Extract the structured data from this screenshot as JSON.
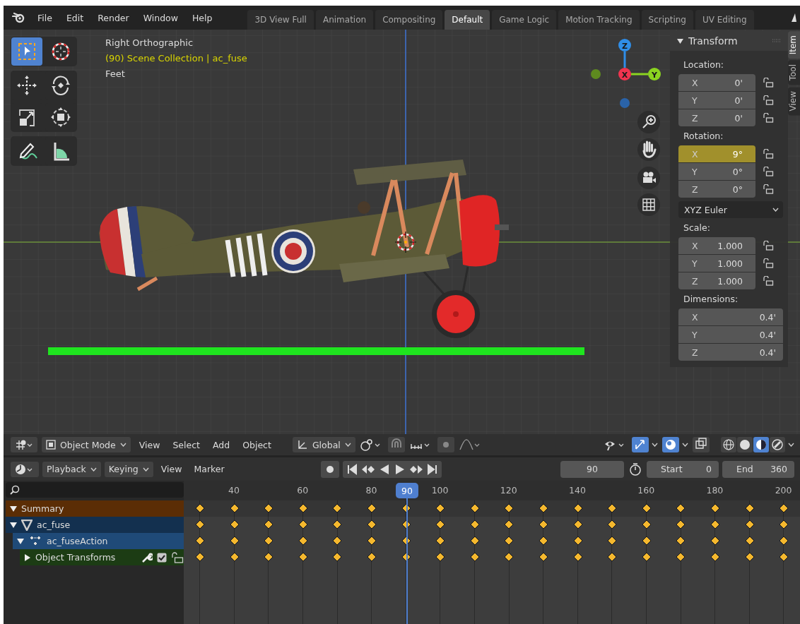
{
  "menus": [
    "File",
    "Edit",
    "Render",
    "Window",
    "Help"
  ],
  "workspaces": [
    {
      "label": "3D View Full",
      "selected": false
    },
    {
      "label": "Animation",
      "selected": false
    },
    {
      "label": "Compositing",
      "selected": false
    },
    {
      "label": "Default",
      "selected": true
    },
    {
      "label": "Game Logic",
      "selected": false
    },
    {
      "label": "Motion Tracking",
      "selected": false
    },
    {
      "label": "Scripting",
      "selected": false
    },
    {
      "label": "UV Editing",
      "selected": false
    }
  ],
  "viewport": {
    "view_name": "Right Orthographic",
    "collection": "(90) Scene Collection | ac_fuse",
    "units": "Feet",
    "tool_groups": [
      [
        {
          "kind": "select",
          "selected": true
        },
        {
          "kind": "cursor",
          "selected": false
        }
      ],
      [
        {
          "kind": "move",
          "selected": false
        },
        {
          "kind": "rotate",
          "selected": false
        },
        {
          "kind": "scale",
          "selected": false
        },
        {
          "kind": "transform",
          "selected": false
        }
      ],
      [
        {
          "kind": "annotate",
          "selected": false
        },
        {
          "kind": "measure",
          "selected": false
        }
      ]
    ],
    "gizmo": {
      "z": "Z",
      "x": "X",
      "y": "Y"
    }
  },
  "sidebar": {
    "tabs": [
      {
        "label": "Item",
        "selected": true
      },
      {
        "label": "Tool",
        "selected": false
      },
      {
        "label": "View",
        "selected": false
      }
    ],
    "panel_title": "Transform",
    "expanded": true,
    "sections": [
      {
        "label": "Location:",
        "kind": "lockable",
        "fields": [
          {
            "axis": "X",
            "value": "0'",
            "keyed": false
          },
          {
            "axis": "Y",
            "value": "0'",
            "keyed": false
          },
          {
            "axis": "Z",
            "value": "0'",
            "keyed": false
          }
        ]
      },
      {
        "label": "Rotation:",
        "kind": "lockable",
        "fields": [
          {
            "axis": "X",
            "value": "9°",
            "keyed": true
          },
          {
            "axis": "Y",
            "value": "0°",
            "keyed": false
          },
          {
            "axis": "Z",
            "value": "0°",
            "keyed": false
          }
        ],
        "mode": "XYZ Euler"
      },
      {
        "label": "Scale:",
        "kind": "lockable",
        "fields": [
          {
            "axis": "X",
            "value": "1.000",
            "keyed": false
          },
          {
            "axis": "Y",
            "value": "1.000",
            "keyed": false
          },
          {
            "axis": "Z",
            "value": "1.000",
            "keyed": false
          }
        ]
      },
      {
        "label": "Dimensions:",
        "kind": "plain",
        "fields": [
          {
            "axis": "X",
            "value": "0.4'",
            "keyed": false
          },
          {
            "axis": "Y",
            "value": "0.4'",
            "keyed": false
          },
          {
            "axis": "Z",
            "value": "0.4'",
            "keyed": false
          }
        ]
      }
    ]
  },
  "header_3d": {
    "mode": "Object Mode",
    "menus": [
      "View",
      "Select",
      "Add",
      "Object"
    ],
    "orientation": "Global",
    "toggles": [
      {
        "kind": "gizmo",
        "on": true
      },
      {
        "kind": "overlay",
        "on": true
      },
      {
        "kind": "xray",
        "on": false
      }
    ],
    "shading": [
      {
        "kind": "wireframe",
        "selected": false
      },
      {
        "kind": "solid",
        "selected": false
      },
      {
        "kind": "material",
        "selected": true
      },
      {
        "kind": "rendered",
        "selected": false
      }
    ]
  },
  "timeline": {
    "menus": [
      {
        "label": "Playback",
        "kind": "dropdown"
      },
      {
        "label": "Keying",
        "kind": "dropdown"
      },
      {
        "label": "View",
        "kind": "plain"
      },
      {
        "label": "Marker",
        "kind": "plain"
      }
    ],
    "current_frame": "90",
    "start_label": "Start",
    "start": "0",
    "end_label": "End",
    "end": "360",
    "ruler_ticks": [
      "40",
      "60",
      "80",
      "100",
      "120",
      "140",
      "160",
      "180",
      "200"
    ],
    "ruler_current": "90"
  },
  "dopesheet": {
    "channels": [
      {
        "name": "Summary",
        "kind": "summary",
        "expanded": true,
        "children": [
          {
            "name": "ac_fuse",
            "kind": "object",
            "expanded": true,
            "children": [
              {
                "name": "ac_fuseAction",
                "kind": "action",
                "expanded": true,
                "children": [
                  {
                    "name": "Object Transforms",
                    "kind": "group",
                    "expanded": false,
                    "checked": true,
                    "locked": false
                  }
                ]
              }
            ]
          }
        ]
      }
    ],
    "keyframes": [
      {
        "selected": true
      },
      {
        "selected": true
      },
      {
        "selected": true
      },
      {
        "selected": true
      },
      {
        "selected": true
      },
      {
        "selected": true
      },
      {
        "selected": true
      },
      {
        "selected": true
      },
      {
        "selected": true
      },
      {
        "selected": true
      },
      {
        "selected": true
      },
      {
        "selected": true
      },
      {
        "selected": true
      },
      {
        "selected": true
      },
      {
        "selected": true
      },
      {
        "selected": true
      },
      {
        "selected": true
      },
      {
        "selected": true
      }
    ]
  }
}
